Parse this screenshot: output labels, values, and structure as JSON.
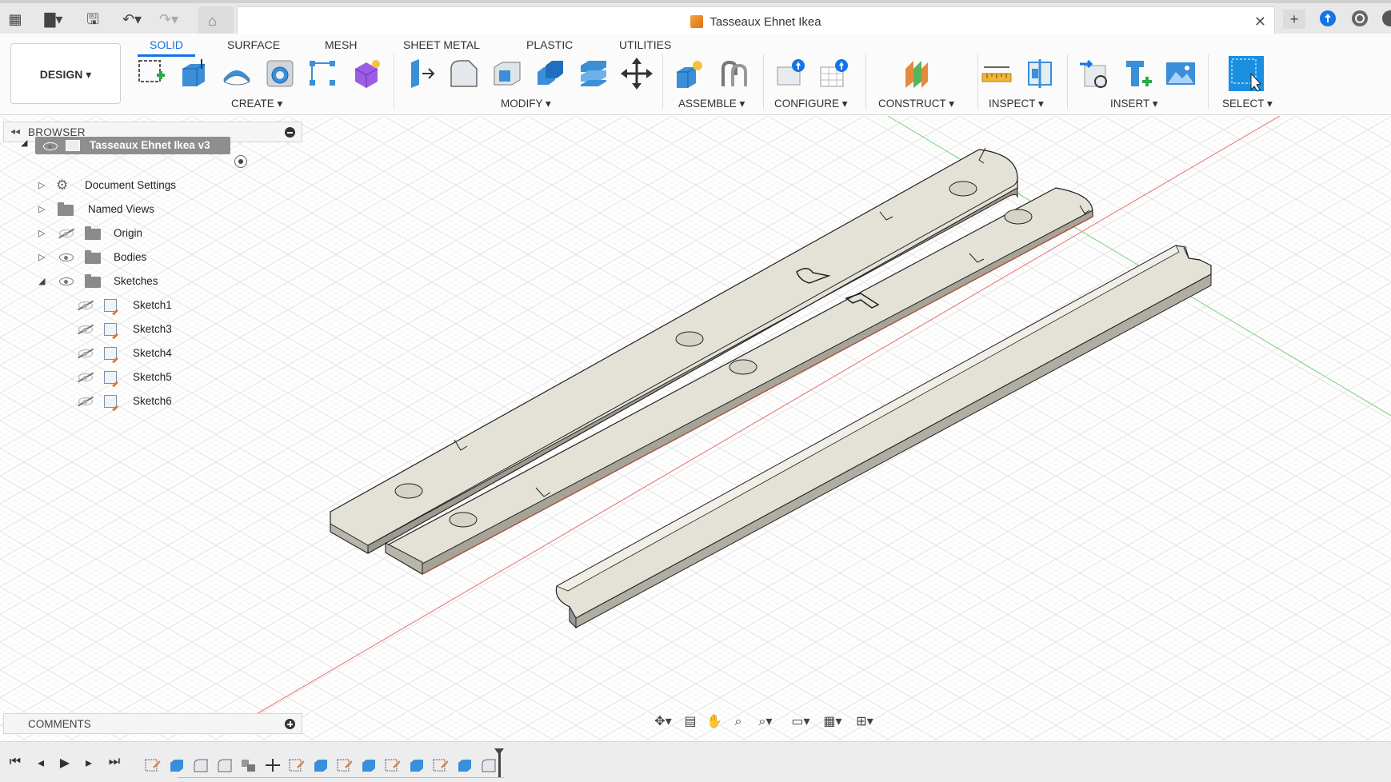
{
  "app": {
    "document_title": "Tasseaux Ehnet Ikea"
  },
  "ribbon": {
    "workspace": "DESIGN ▾",
    "tabs": [
      "SOLID",
      "SURFACE",
      "MESH",
      "SHEET METAL",
      "PLASTIC",
      "UTILITIES"
    ],
    "active_tab": "SOLID",
    "groups": {
      "create": "CREATE ▾",
      "modify": "MODIFY ▾",
      "assemble": "ASSEMBLE ▾",
      "configure": "CONFIGURE ▾",
      "construct": "CONSTRUCT ▾",
      "inspect": "INSPECT ▾",
      "insert": "INSERT ▾",
      "select": "SELECT ▾"
    }
  },
  "browser": {
    "title": "BROWSER",
    "root": "Tasseaux Ehnet Ikea v3",
    "items": [
      {
        "label": "Document Settings",
        "icon": "gear-icon"
      },
      {
        "label": "Named Views",
        "icon": "folder-icon"
      },
      {
        "label": "Origin",
        "icon": "folder-icon",
        "visible": false
      },
      {
        "label": "Bodies",
        "icon": "folder-icon",
        "visible": true
      },
      {
        "label": "Sketches",
        "icon": "folder-icon",
        "visible": true,
        "expanded": true
      }
    ],
    "sketches": [
      "Sketch1",
      "Sketch3",
      "Sketch4",
      "Sketch5",
      "Sketch6"
    ]
  },
  "comments": {
    "title": "COMMENTS"
  },
  "colors": {
    "accent": "#1473e6",
    "body_fill": "#e4e1d7",
    "body_side": "#b8b5ab",
    "grid": "#e6e6e6",
    "axis_x": "#e05050",
    "axis_y": "#60c060"
  }
}
